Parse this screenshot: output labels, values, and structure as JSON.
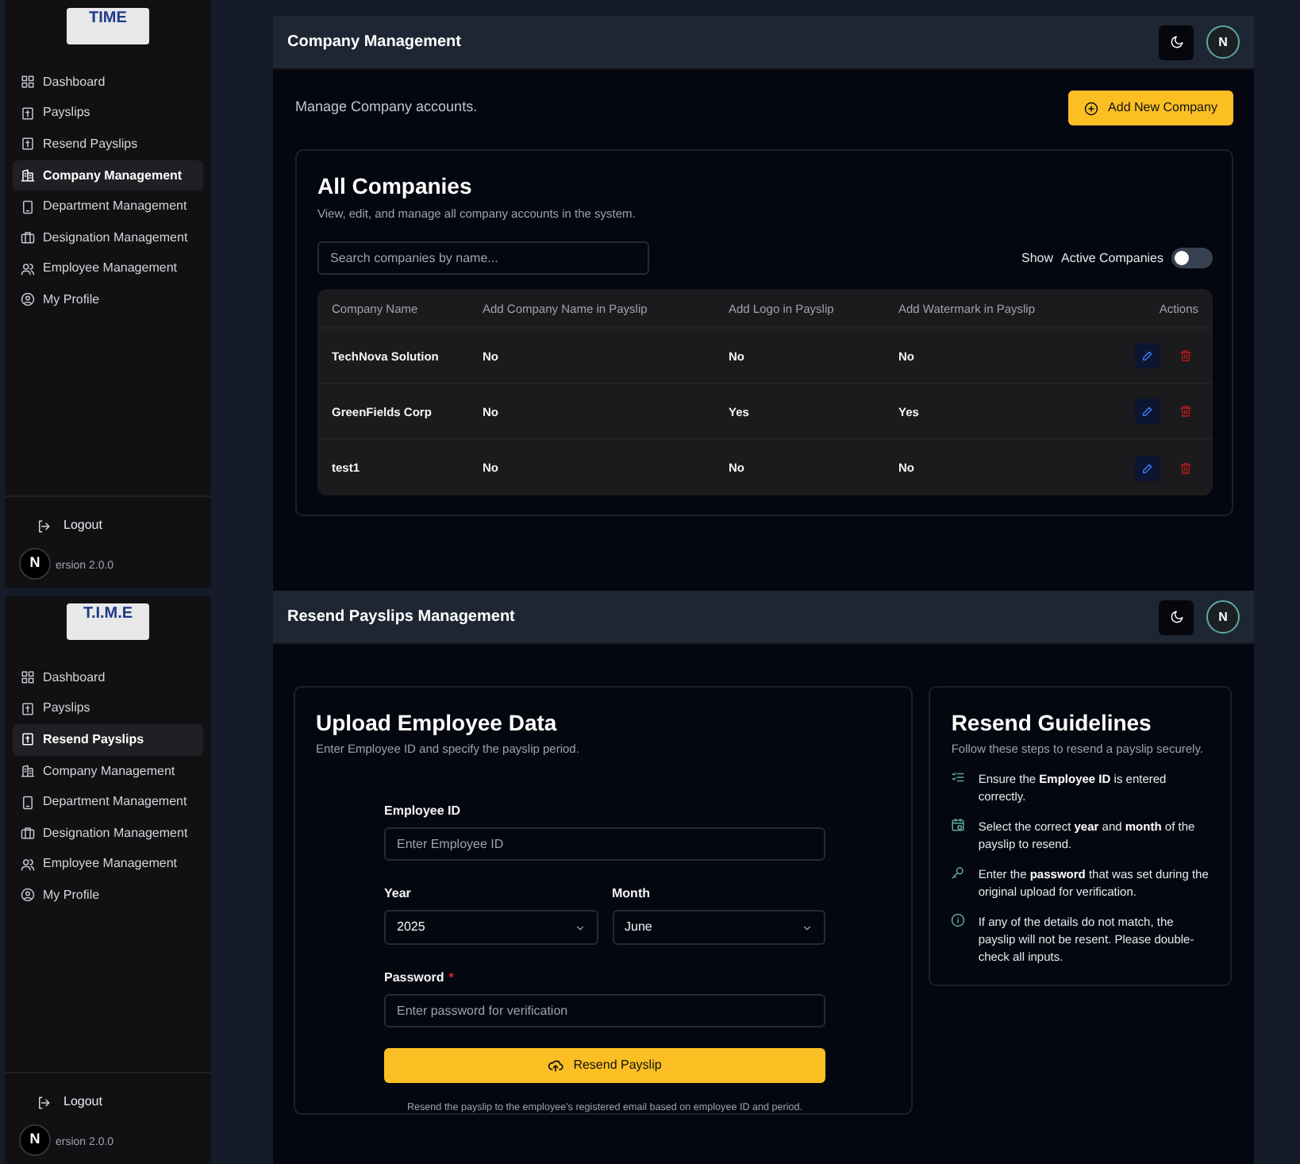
{
  "screens": [
    {
      "kind": "companies",
      "sidebar": {
        "logo_text": "TIME",
        "items": [
          {
            "label": "Dashboard",
            "selected": false
          },
          {
            "label": "Payslips",
            "selected": false
          },
          {
            "label": "Resend Payslips",
            "selected": false
          },
          {
            "label": "Company Management",
            "selected": true
          },
          {
            "label": "Department Management",
            "selected": false
          },
          {
            "label": "Designation Management",
            "selected": false
          },
          {
            "label": "Employee Management",
            "selected": false
          },
          {
            "label": "My Profile",
            "selected": false
          }
        ],
        "logout": "Logout",
        "version": "ersion 2.0.0",
        "badge": "N"
      },
      "header": {
        "title": "Company Management",
        "avatar": "N"
      },
      "intro": "Manage Company accounts.",
      "add_button": "Add New Company",
      "card": {
        "title": "All Companies",
        "subtitle": "View, edit, and manage all company accounts in the system.",
        "search": {
          "placeholder": "Search companies by name..."
        },
        "toggle": {
          "label_1": "Show",
          "label_2": "Active Companies",
          "on": false
        },
        "table": {
          "columns": [
            "Company Name",
            "Add Company Name in Payslip",
            "Add Logo in Payslip",
            "Add Watermark in Payslip",
            "Actions"
          ],
          "rows": [
            [
              "TechNova Solution",
              "No",
              "No",
              "No"
            ],
            [
              "GreenFields Corp",
              "No",
              "Yes",
              "Yes"
            ],
            [
              "test1",
              "No",
              "No",
              "No"
            ]
          ]
        }
      }
    },
    {
      "kind": "resend",
      "sidebar": {
        "logo_text": "T.I.M.E",
        "items": [
          {
            "label": "Dashboard",
            "selected": false
          },
          {
            "label": "Payslips",
            "selected": false
          },
          {
            "label": "Resend Payslips",
            "selected": true
          },
          {
            "label": "Company Management",
            "selected": false
          },
          {
            "label": "Department Management",
            "selected": false
          },
          {
            "label": "Designation Management",
            "selected": false
          },
          {
            "label": "Employee Management",
            "selected": false
          },
          {
            "label": "My Profile",
            "selected": false
          }
        ],
        "logout": "Logout",
        "version": "ersion 2.0.0",
        "badge": "N"
      },
      "header": {
        "title": "Resend Payslips Management",
        "avatar": "N"
      },
      "upload": {
        "title": "Upload Employee Data",
        "subtitle": "Enter Employee ID and specify the payslip period.",
        "employee_id": {
          "label": "Employee ID",
          "placeholder": "Enter Employee ID"
        },
        "year": {
          "label": "Year",
          "value": "2025"
        },
        "month": {
          "label": "Month",
          "value": "June"
        },
        "password": {
          "label": "Password",
          "required_mark": "*",
          "placeholder": "Enter password for verification"
        },
        "button": "Resend Payslip",
        "note": "Resend the payslip to the employee's registered email based on employee ID and period."
      },
      "guidelines": {
        "title": "Resend Guidelines",
        "subtitle": "Follow these steps to resend a payslip securely.",
        "items": [
          "Ensure the **Employee ID** is entered correctly.",
          "Select the correct **year** and **month** of the payslip to resend.",
          "Enter the **password** that was set during the original upload for verification.",
          "If any of the details do not match, the payslip will not be resent. Please double-check all inputs."
        ]
      }
    }
  ]
}
